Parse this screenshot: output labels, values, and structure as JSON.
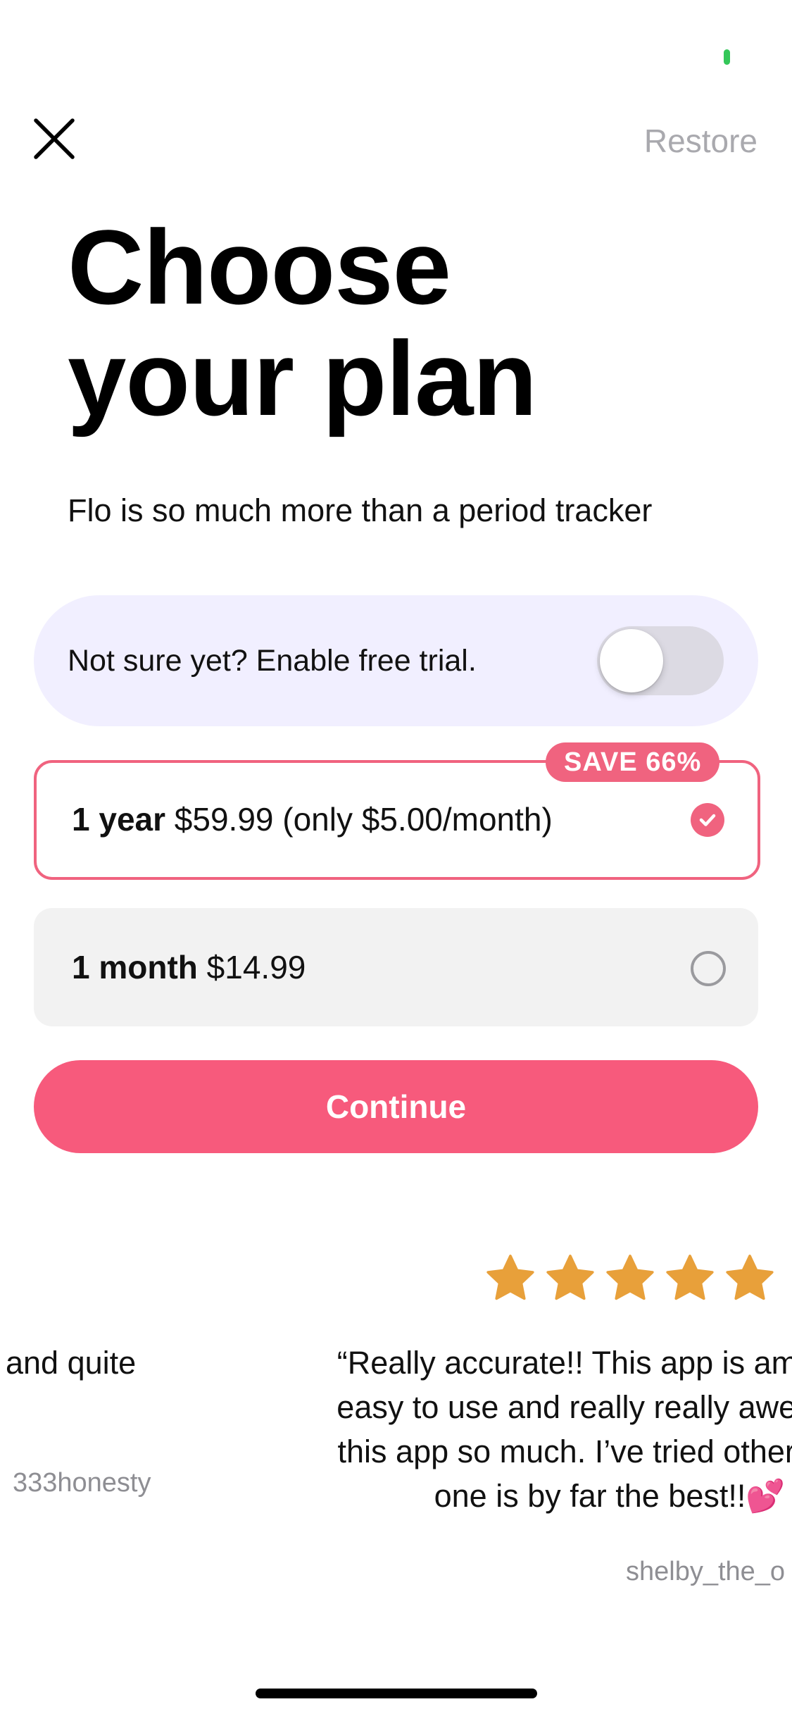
{
  "header": {
    "close_icon": "close-icon",
    "restore_label": "Restore"
  },
  "title": {
    "line1": "Choose",
    "line2": "your plan"
  },
  "subtitle": "Flo is so much more than a period tracker",
  "trial": {
    "label": "Not sure yet? Enable free trial.",
    "enabled": false
  },
  "plans": [
    {
      "name": "1 year",
      "price": "$59.99 (only $5.00/month)",
      "badge": "SAVE 66%",
      "selected": true
    },
    {
      "name": "1 month",
      "price": "$14.99",
      "selected": false
    }
  ],
  "continue_label": "Continue",
  "reviews": {
    "rating_stars": 5,
    "star_color": "#e8a03a",
    "previous": {
      "text_fragment": "and quite",
      "author": "333honesty"
    },
    "current": {
      "text": "“Really accurate!! This app is amazing,\neasy to use and really really awesome!\nthis app so much. I’ve tried other apps,\none is by far the best!!💕",
      "author": "shelby_the_o"
    }
  },
  "colors": {
    "accent": "#f75a7c",
    "accent_border": "#f0637f",
    "trial_background": "#f1efff",
    "status_green": "#34c759"
  }
}
